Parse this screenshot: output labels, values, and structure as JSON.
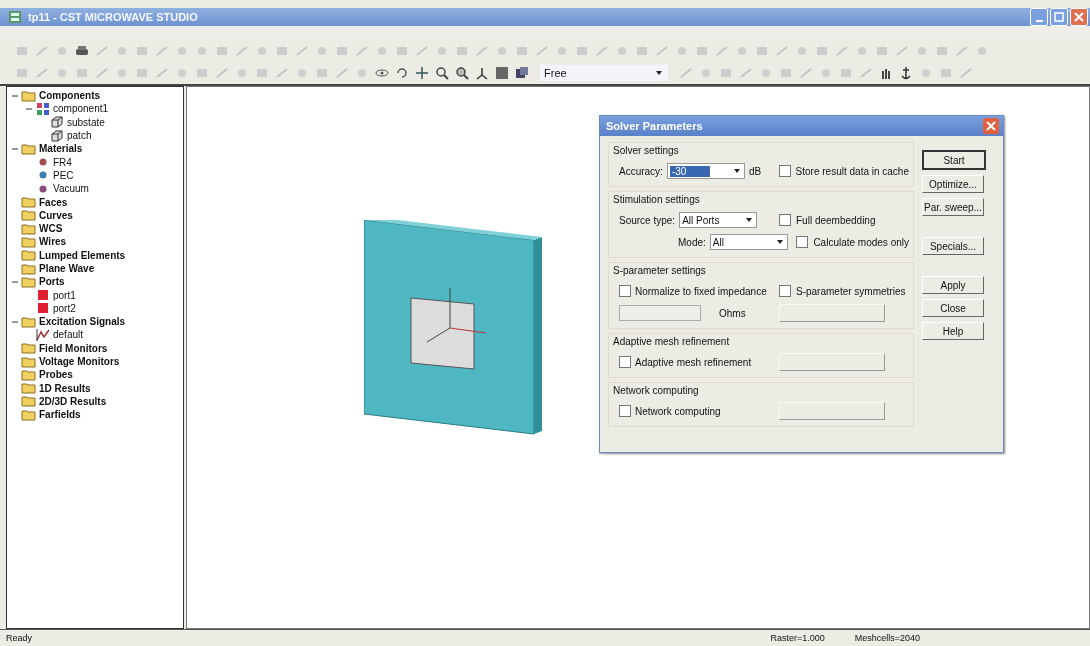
{
  "window": {
    "title": "tp11 - CST MICROWAVE STUDIO"
  },
  "toolbar": {
    "view_mode": "Free"
  },
  "tree": [
    {
      "label": "Components",
      "kind": "folder",
      "expanded": true,
      "children": [
        {
          "label": "component1",
          "kind": "component",
          "expanded": true,
          "children": [
            {
              "label": "substate",
              "kind": "solid"
            },
            {
              "label": "patch",
              "kind": "solid"
            }
          ]
        }
      ]
    },
    {
      "label": "Materials",
      "kind": "folder",
      "expanded": true,
      "children": [
        {
          "label": "FR4",
          "kind": "material",
          "color": "#a05050"
        },
        {
          "label": "PEC",
          "kind": "material",
          "color": "#3a7fb0"
        },
        {
          "label": "Vacuum",
          "kind": "material",
          "color": "#8a4a7a"
        }
      ]
    },
    {
      "label": "Faces",
      "kind": "folder"
    },
    {
      "label": "Curves",
      "kind": "folder"
    },
    {
      "label": "WCS",
      "kind": "folder"
    },
    {
      "label": "Wires",
      "kind": "folder"
    },
    {
      "label": "Lumped Elements",
      "kind": "folder"
    },
    {
      "label": "Plane Wave",
      "kind": "folder"
    },
    {
      "label": "Ports",
      "kind": "folder",
      "expanded": true,
      "children": [
        {
          "label": "port1",
          "kind": "port"
        },
        {
          "label": "port2",
          "kind": "port"
        }
      ]
    },
    {
      "label": "Excitation Signals",
      "kind": "folder",
      "expanded": true,
      "children": [
        {
          "label": "default",
          "kind": "signal"
        }
      ]
    },
    {
      "label": "Field Monitors",
      "kind": "folder"
    },
    {
      "label": "Voltage Monitors",
      "kind": "folder"
    },
    {
      "label": "Probes",
      "kind": "folder"
    },
    {
      "label": "1D Results",
      "kind": "folder"
    },
    {
      "label": "2D/3D Results",
      "kind": "folder"
    },
    {
      "label": "Farfields",
      "kind": "folder"
    }
  ],
  "dialog": {
    "title": "Solver Parameters",
    "groups": [
      {
        "title": "Solver settings",
        "rows": [
          [
            {
              "kind": "select",
              "label": "Accuracy:",
              "value": "-30",
              "unit": "dB",
              "highlighted": true
            },
            {
              "kind": "checkbox",
              "label": "Store result data in cache",
              "checked": false,
              "disabled": false
            }
          ]
        ]
      },
      {
        "title": "Stimulation settings",
        "rows": [
          [
            {
              "kind": "select",
              "label": "Source type:",
              "value": "All Ports",
              "highlighted": false
            },
            {
              "kind": "checkbox",
              "label": "Full deembedding",
              "checked": false,
              "disabled": false
            }
          ],
          [
            {
              "kind": "select",
              "label": "Mode:",
              "value": "All",
              "highlighted": false
            },
            {
              "kind": "checkbox",
              "label": "Calculate modes only",
              "checked": false,
              "disabled": false
            }
          ]
        ]
      },
      {
        "title": "S-parameter settings",
        "rows": [
          [
            {
              "kind": "checkbox",
              "label": "Normalize to fixed impedance",
              "checked": false,
              "disabled": false
            },
            {
              "kind": "checkbox",
              "label": "S-parameter symmetries",
              "checked": false,
              "disabled": false
            }
          ],
          [
            {
              "kind": "input",
              "unit": "Ohms",
              "disabled": true
            },
            {
              "kind": "button",
              "disabled": true
            }
          ]
        ]
      },
      {
        "title": "Adaptive mesh refinement",
        "rows": [
          [
            {
              "kind": "checkbox",
              "label": "Adaptive mesh refinement",
              "checked": false,
              "disabled": false
            },
            {
              "kind": "button",
              "disabled": true
            }
          ]
        ]
      },
      {
        "title": "Network computing",
        "rows": [
          [
            {
              "kind": "checkbox",
              "label": "Network computing",
              "checked": false,
              "disabled": false
            },
            {
              "kind": "button",
              "disabled": true
            }
          ]
        ]
      }
    ],
    "buttons": [
      {
        "label": "Start",
        "default": true
      },
      {
        "label": "Optimize...",
        "default": false
      },
      {
        "label": "Par. sweep...",
        "default": false
      },
      {
        "label": "Specials...",
        "default": false
      },
      {
        "label": "Apply",
        "default": false
      },
      {
        "label": "Close",
        "default": false
      },
      {
        "label": "Help",
        "default": false
      }
    ]
  },
  "status_bar": {
    "message": "Ready",
    "fields": [
      "Raster=1.000",
      "Meshcells=2040"
    ]
  }
}
